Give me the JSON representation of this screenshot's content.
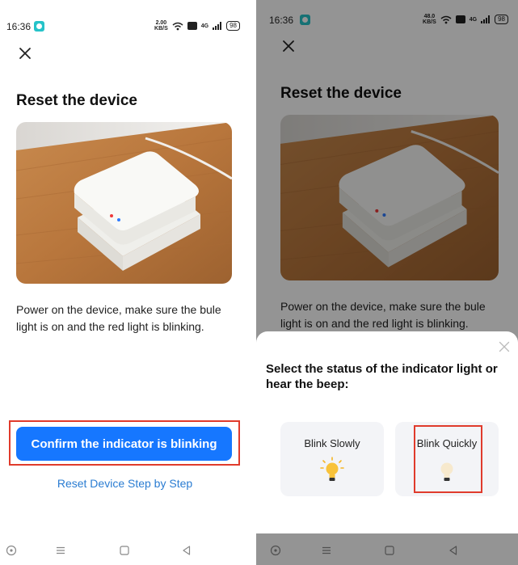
{
  "status_bar": {
    "time": "16:36",
    "left_speed": "2.00",
    "right_speed": "48.0",
    "speed_unit": "KB/S",
    "network": "4G",
    "battery": "98"
  },
  "left_screen": {
    "title": "Reset the device",
    "instruction": "Power on the device, make sure the bule light is on and the red light is blinking.",
    "confirm_button": "Confirm the indicator is blinking",
    "step_link": "Reset Device Step by Step"
  },
  "right_screen": {
    "title": "Reset the device",
    "instruction": "Power on the device, make sure the bule light is on and the red light is blinking.",
    "sheet": {
      "title": "Select the status of the indicator light or hear the beep:",
      "options": [
        {
          "label": "Blink Slowly"
        },
        {
          "label": "Blink Quickly"
        }
      ]
    }
  },
  "colors": {
    "primary": "#1677ff",
    "link": "#2a7cd2",
    "highlight": "#e03b2c",
    "badge": "#26c3c9"
  },
  "icons": {
    "close": "close-icon",
    "nav_back": "back-triangle-icon",
    "nav_home": "home-square-icon",
    "nav_menu": "menu-lines-icon",
    "nav_assist": "assist-circle-icon",
    "bulb": "lightbulb-icon"
  }
}
